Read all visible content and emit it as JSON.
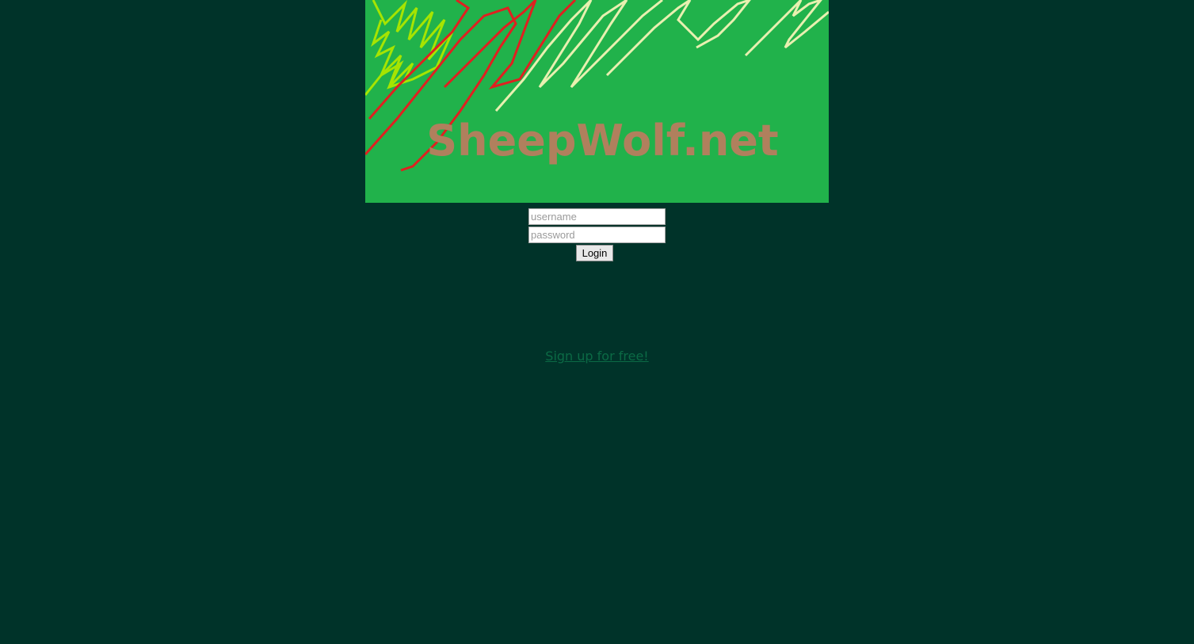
{
  "banner": {
    "title": "SheepWolf.net",
    "background_color": "#21b24b",
    "title_color": "#b0805d",
    "scribble_colors": [
      "#a6e400",
      "#e02020",
      "#e8f0b0"
    ]
  },
  "login": {
    "username_placeholder": "username",
    "password_placeholder": "password",
    "username_value": "",
    "password_value": "",
    "submit_label": "Login"
  },
  "signup": {
    "link_text": "Sign up for free!"
  },
  "colors": {
    "page_background": "#003329",
    "link_color": "#0b6a45"
  }
}
